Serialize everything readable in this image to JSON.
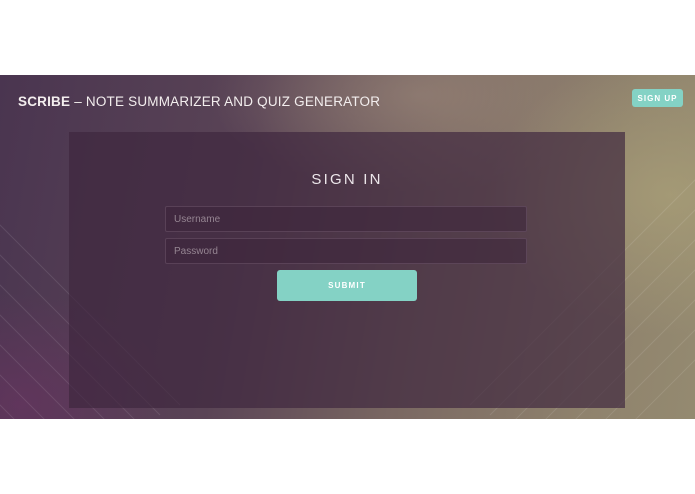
{
  "header": {
    "brand": "SCRIBE",
    "tagline": "– NOTE SUMMARIZER AND QUIZ GENERATOR",
    "signup_label": "SIGN UP"
  },
  "signin": {
    "title": "SIGN IN",
    "username": {
      "value": "",
      "placeholder": "Username"
    },
    "password": {
      "value": "",
      "placeholder": "Password"
    },
    "submit_label": "SUBMIT"
  },
  "colors": {
    "accent": "#84d2c5",
    "panel": "#3e263e",
    "text": "#f3eeee"
  }
}
